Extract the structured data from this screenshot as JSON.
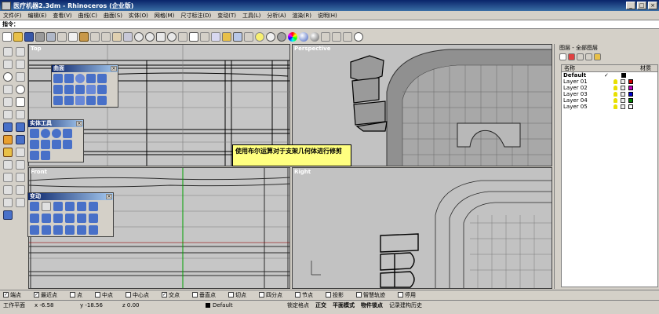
{
  "window": {
    "title": "医疗机器2.3dm - Rhinoceros (企业版)",
    "min_label": "_",
    "max_label": "□",
    "close_label": "×"
  },
  "menu": [
    "文件(F)",
    "编辑(E)",
    "查看(V)",
    "曲线(C)",
    "曲面(S)",
    "实体(O)",
    "网格(M)",
    "尺寸标注(D)",
    "变动(T)",
    "工具(L)",
    "分析(A)",
    "渲染(R)",
    "说明(H)"
  ],
  "command": {
    "label": "指令：",
    "value": ""
  },
  "viewports": {
    "top": "Top",
    "perspective": "Perspective",
    "front": "Front",
    "right": "Right"
  },
  "palettes": {
    "surface": {
      "title": "曲面",
      "close": "×"
    },
    "solid": {
      "title": "实体工具",
      "close": "×"
    },
    "transform": {
      "title": "变动",
      "close": "×"
    }
  },
  "callout": "使用布尔运算对于支架几何体进行修剪",
  "layers_panel": {
    "title": "图层 - 全部图层",
    "col_name": "名称",
    "col_material": "材质",
    "rows": [
      {
        "name": "Default",
        "current": true,
        "check": "✓",
        "color": "#000000"
      },
      {
        "name": "Layer 01",
        "current": false,
        "check": "",
        "color": "#cc0000"
      },
      {
        "name": "Layer 02",
        "current": false,
        "check": "",
        "color": "#c000c0"
      },
      {
        "name": "Layer 03",
        "current": false,
        "check": "",
        "color": "#0000cc"
      },
      {
        "name": "Layer 04",
        "current": false,
        "check": "",
        "color": "#008000"
      },
      {
        "name": "Layer 05",
        "current": false,
        "check": "",
        "color": "#ffffff"
      }
    ]
  },
  "osnaps": [
    {
      "label": "端点",
      "checked": true
    },
    {
      "label": "最近点",
      "checked": true
    },
    {
      "label": "点",
      "checked": false
    },
    {
      "label": "中点",
      "checked": false
    },
    {
      "label": "中心点",
      "checked": false
    },
    {
      "label": "交点",
      "checked": true
    },
    {
      "label": "垂直点",
      "checked": false
    },
    {
      "label": "切点",
      "checked": false
    },
    {
      "label": "四分点",
      "checked": false
    },
    {
      "label": "节点",
      "checked": false
    },
    {
      "label": "投影",
      "checked": false
    },
    {
      "label": "智慧轨迹",
      "checked": false
    },
    {
      "label": "停用",
      "checked": false
    }
  ],
  "status": {
    "cplane": "工作平面",
    "x": "x -6.58",
    "y": "y -18.56",
    "z": "z 0.00",
    "layer": "Default",
    "grid_snap": "锁定格点",
    "ortho": "正交",
    "planar": "平面模式",
    "osnap": "物件锁点",
    "history": "记录建构历史"
  },
  "colors": {
    "title_start": "#0a246a",
    "title_end": "#3a6ea5",
    "callout_bg": "#ffff80",
    "viewport_bg": "#c6c6c6"
  }
}
